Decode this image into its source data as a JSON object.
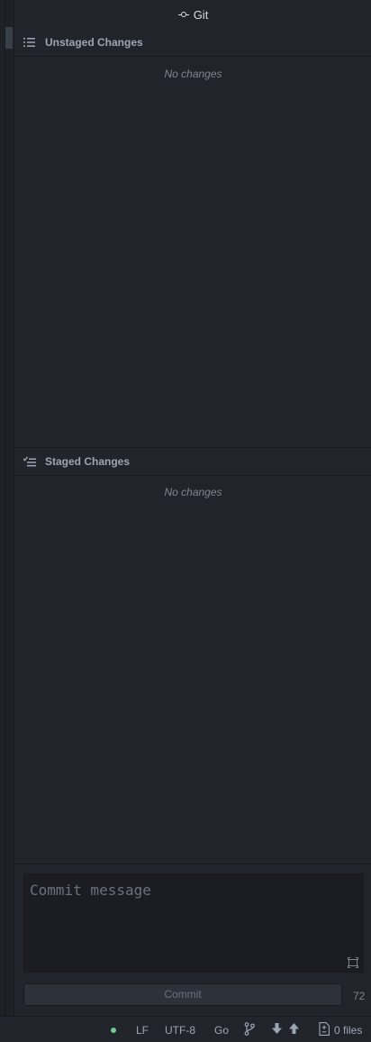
{
  "git_tab": {
    "label": "Git"
  },
  "unstaged": {
    "title": "Unstaged Changes",
    "empty_text": "No changes"
  },
  "staged": {
    "title": "Staged Changes",
    "empty_text": "No changes"
  },
  "commit": {
    "placeholder": "Commit message",
    "value": "",
    "button_label": "Commit",
    "remaining_chars": "72"
  },
  "status_bar": {
    "line_ending": "LF",
    "encoding": "UTF-8",
    "grammar": "Go",
    "files_label": "0 files",
    "status_color": "#73c991"
  },
  "icons": {
    "git_tab": "git-commit-icon",
    "unstaged": "list-unordered-icon",
    "staged": "checklist-icon",
    "expand": "expand-icon",
    "branch": "git-branch-icon",
    "fetch": "arrow-down-icon",
    "push": "arrow-up-icon",
    "file": "file-diff-icon"
  }
}
